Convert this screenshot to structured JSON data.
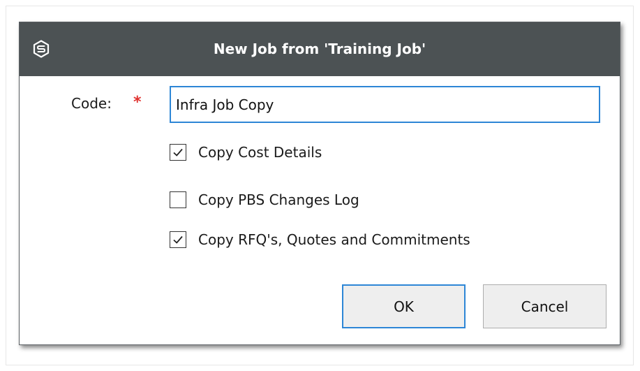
{
  "dialog": {
    "title": "New Job from 'Training Job'",
    "icon": "app-logo-icon"
  },
  "form": {
    "code_label": "Code:",
    "required_marker": "*",
    "code_value": "Infra Job Copy"
  },
  "options": [
    {
      "label": "Copy Cost Details",
      "checked": true
    },
    {
      "label": "Copy PBS Changes Log",
      "checked": false
    },
    {
      "label": "Copy RFQ's, Quotes and Commitments",
      "checked": true
    }
  ],
  "buttons": {
    "ok_label": "OK",
    "cancel_label": "Cancel"
  },
  "colors": {
    "titlebar": "#4c5254",
    "focus_border": "#2d86d6",
    "required": "#e0322f"
  }
}
